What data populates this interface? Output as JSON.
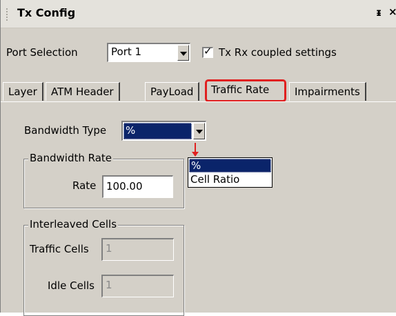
{
  "panel": {
    "title": "Tx Config",
    "pin_glyph": "ᵻ",
    "close_glyph": "×"
  },
  "port": {
    "label": "Port Selection",
    "value": "Port 1"
  },
  "coupled": {
    "label": "Tx Rx coupled settings",
    "checked": true
  },
  "tabs": [
    {
      "label": "Layer"
    },
    {
      "label": "ATM Header"
    },
    {
      "label": "PayLoad"
    },
    {
      "label": "Traffic Rate",
      "active": true
    },
    {
      "label": "Impairments"
    }
  ],
  "bandwidth_type": {
    "label": "Bandwidth Type",
    "value": "%",
    "options": [
      "%",
      "Cell Ratio"
    ]
  },
  "bandwidth_rate": {
    "group_title": "Bandwidth Rate",
    "rate_label": "Rate",
    "rate_value": "100.00"
  },
  "interleaved": {
    "group_title": "Interleaved Cells",
    "traffic_label": "Traffic Cells",
    "traffic_value": "1",
    "idle_label": "Idle Cells",
    "idle_value": "1"
  },
  "colors": {
    "highlight": "#0a246a",
    "annotation": "#e02020",
    "panel_bg": "#d4d0c8"
  }
}
